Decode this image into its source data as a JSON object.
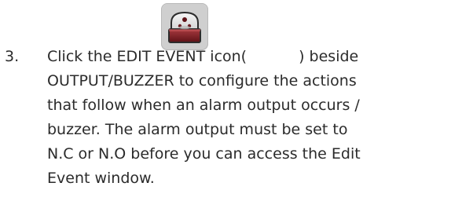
{
  "step": {
    "number": "3.",
    "line1_before_icon": "Click the EDIT EVENT icon(",
    "line1_after_icon": ") beside",
    "line2": "OUTPUT/BUZZER to configure the actions",
    "line3": "that follow when an alarm output occurs /",
    "line4": "buzzer. The alarm output must be set to",
    "line5": "N.C or N.O before you can access the Edit",
    "line6": "Event window."
  },
  "icons": {
    "edit_event": "edit-event-icon"
  }
}
